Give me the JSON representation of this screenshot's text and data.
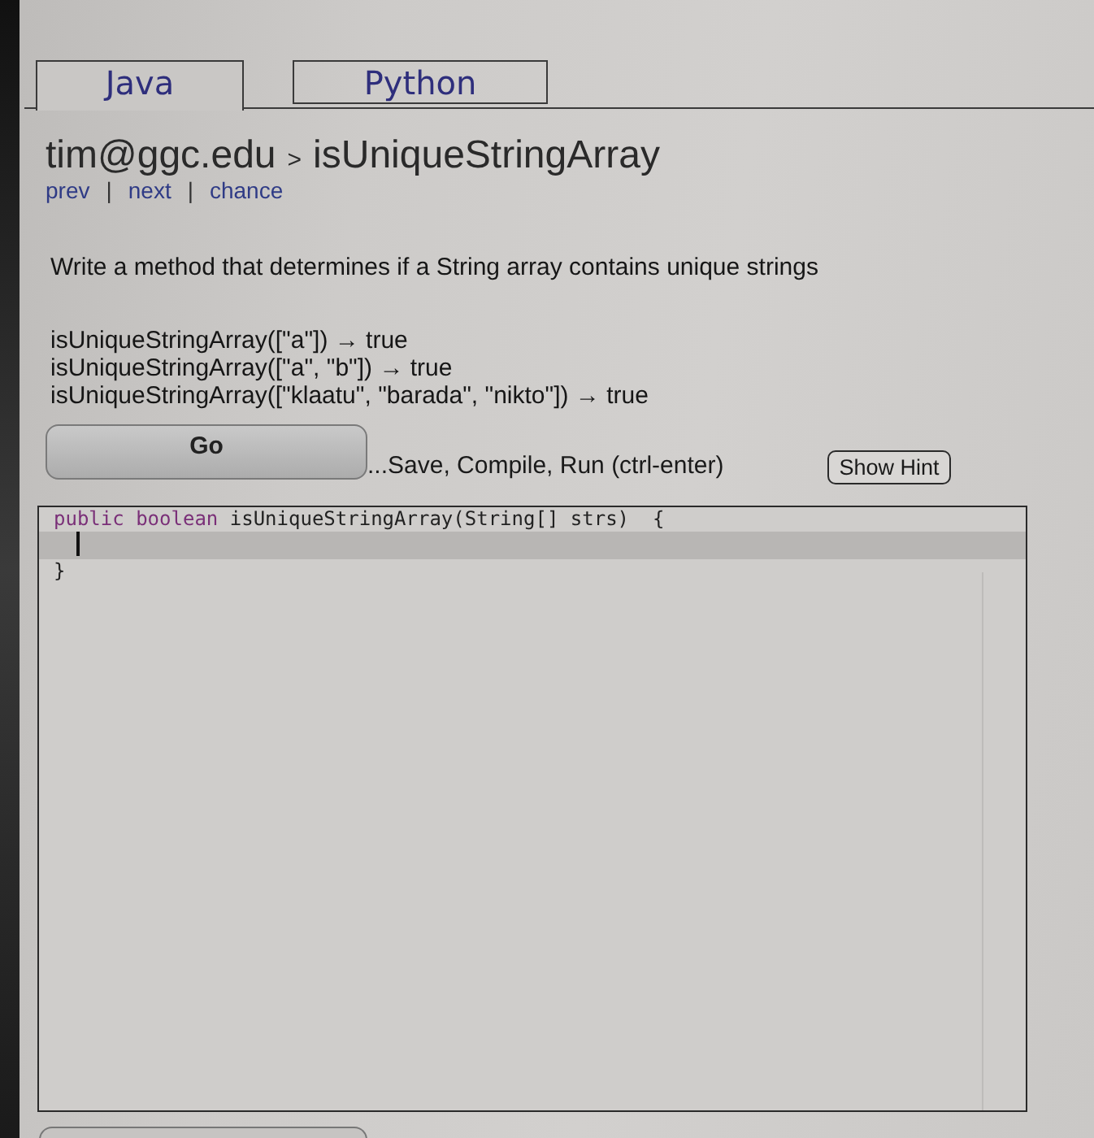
{
  "tabs": [
    {
      "label": "Java",
      "selected": true
    },
    {
      "label": "Python",
      "selected": false
    }
  ],
  "breadcrumb": {
    "user": "tim@ggc.edu",
    "separator": ">",
    "problem": "isUniqueStringArray"
  },
  "nav": [
    {
      "kind": "link",
      "text": "prev"
    },
    {
      "kind": "separator",
      "text": "|"
    },
    {
      "kind": "link",
      "text": "next"
    },
    {
      "kind": "separator",
      "text": "|"
    },
    {
      "kind": "link",
      "text": "chance"
    }
  ],
  "description": "Write a method that determines if a String array contains unique strings",
  "examples": [
    "isUniqueStringArray([\"a\"]) → true",
    "isUniqueStringArray([\"a\", \"b\"]) → true",
    "isUniqueStringArray([\"klaatu\", \"barada\", \"nikto\"]) → true"
  ],
  "go_button": "Go",
  "run_hint": "...Save, Compile, Run (ctrl-enter)",
  "hint_button": "Show Hint",
  "editor": {
    "lines": [
      {
        "active": false,
        "segments": [
          {
            "kind": "keyword",
            "text": "public boolean"
          },
          {
            "kind": "plain",
            "text": " isUniqueStringArray(String[] strs)  {"
          }
        ]
      },
      {
        "active": true,
        "cursor": true
      },
      {
        "active": false,
        "segments": [
          {
            "kind": "plain",
            "text": "}"
          }
        ]
      }
    ]
  }
}
